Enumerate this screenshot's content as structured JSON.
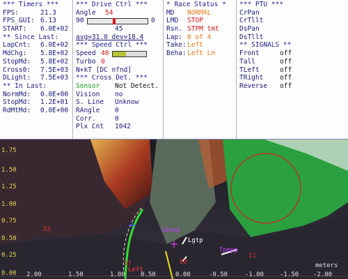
{
  "timers": {
    "header": "*** Timers ***",
    "rows": [
      {
        "label": "FPS:",
        "value": "21.3"
      },
      {
        "label": "FPS_GUI:",
        "value": "6.13"
      },
      {
        "label": "START:",
        "value": "6.0E+02"
      }
    ],
    "since_header": "** Since Last:",
    "since_rows": [
      {
        "label": "LapCnt:",
        "value": "6.0E+02"
      },
      {
        "label": "MdChg:",
        "value": "5.8E+02"
      },
      {
        "label": "StopMd:",
        "value": "5.8E+02"
      },
      {
        "label": "Cross0:",
        "value": "7.5E+03"
      },
      {
        "label": "DLight:",
        "value": "7.5E+03"
      }
    ],
    "in_header": "** In Last:",
    "in_rows": [
      {
        "label": "NormMd:",
        "value": "0.0E+00"
      },
      {
        "label": "StopMd:",
        "value": "1.2E+01"
      },
      {
        "label": "RdMtMd:",
        "value": "0.0E+00"
      }
    ]
  },
  "drive": {
    "header": "*** Drive Ctrl ***",
    "angle_label": "Angle",
    "angle_value": "54",
    "slider_min": "90",
    "slider_max": "0",
    "slider_level": 0.44,
    "slider_below": "45",
    "avg_text": "avg=31.0  dev=18.4",
    "speed_header": "*** Speed Ctrl ***",
    "speed_label": "Speed",
    "speed_value": "40",
    "speed_level": 0.4,
    "turbo_label": "Turbo",
    "turbo_value": "0",
    "nkt_text": "N+kT [DC nfnd]",
    "cross_header": "*** Cross Det. ***",
    "cross_rows": [
      {
        "label": "Sensor",
        "value": "Not Detect."
      },
      {
        "label": "Vision",
        "value": "no"
      },
      {
        "label": "S. Line",
        "value": "Unknow"
      },
      {
        "label": "RAngle",
        "value": "0"
      },
      {
        "label": "Corr.",
        "value": "0"
      },
      {
        "label": "Plx Cnt",
        "value": "1042"
      }
    ]
  },
  "race": {
    "header": "* Race Status *",
    "rows": [
      {
        "label": "MD",
        "value": "NORMAL",
        "color": "#e07a1a"
      },
      {
        "label": "LMD",
        "value": "STOP",
        "color": "#d41a1a"
      },
      {
        "label": "Rsn.",
        "value": "STPM tmt",
        "color": "#d41a1a"
      },
      {
        "label": "Lap:",
        "value": "0 of 4",
        "color": "#e07a1a"
      },
      {
        "label": "Take:",
        "value": "Left",
        "color": "#e07a1a"
      },
      {
        "label": "Beha:",
        "value": "Left Ln",
        "color": "#e07a1a"
      }
    ]
  },
  "ptu": {
    "header": "*** PTU ***",
    "items": [
      "CrPan",
      "CrTllt",
      "DsPan",
      "DsTllt"
    ],
    "signals_header": "** SIGNALS **",
    "signals": [
      {
        "label": "Front",
        "value": "off"
      },
      {
        "label": "Tall",
        "value": "off"
      },
      {
        "label": "TLeft",
        "value": "off"
      },
      {
        "label": "TRight",
        "value": "off"
      },
      {
        "label": "Reverse",
        "value": "off"
      }
    ]
  },
  "camera": {
    "y_ticks": [
      "1.75",
      "1.50",
      "1.25",
      "1.00",
      "0.75",
      "0.50",
      "0.25",
      "0.00"
    ],
    "x_ticks": [
      "2.00",
      "1.50",
      "1.00",
      "0.50",
      "0.00",
      "-0.50",
      "-1.00",
      "-1.50",
      "-2.00"
    ],
    "units": "meters",
    "markers": [
      {
        "text": "53",
        "color": "#e03030"
      },
      {
        "text": "Lmcpp",
        "color": "#c040ff"
      },
      {
        "text": "Lgtp",
        "color": "#ffffff"
      },
      {
        "text": "Tpmpp",
        "color": "#c040ff"
      },
      {
        "text": "11",
        "color": "#e03030"
      },
      {
        "text": "57",
        "color": "#e03030"
      },
      {
        "text": "Left",
        "color": "#ff4040"
      },
      {
        "text": "09",
        "color": "#e03030"
      }
    ]
  }
}
